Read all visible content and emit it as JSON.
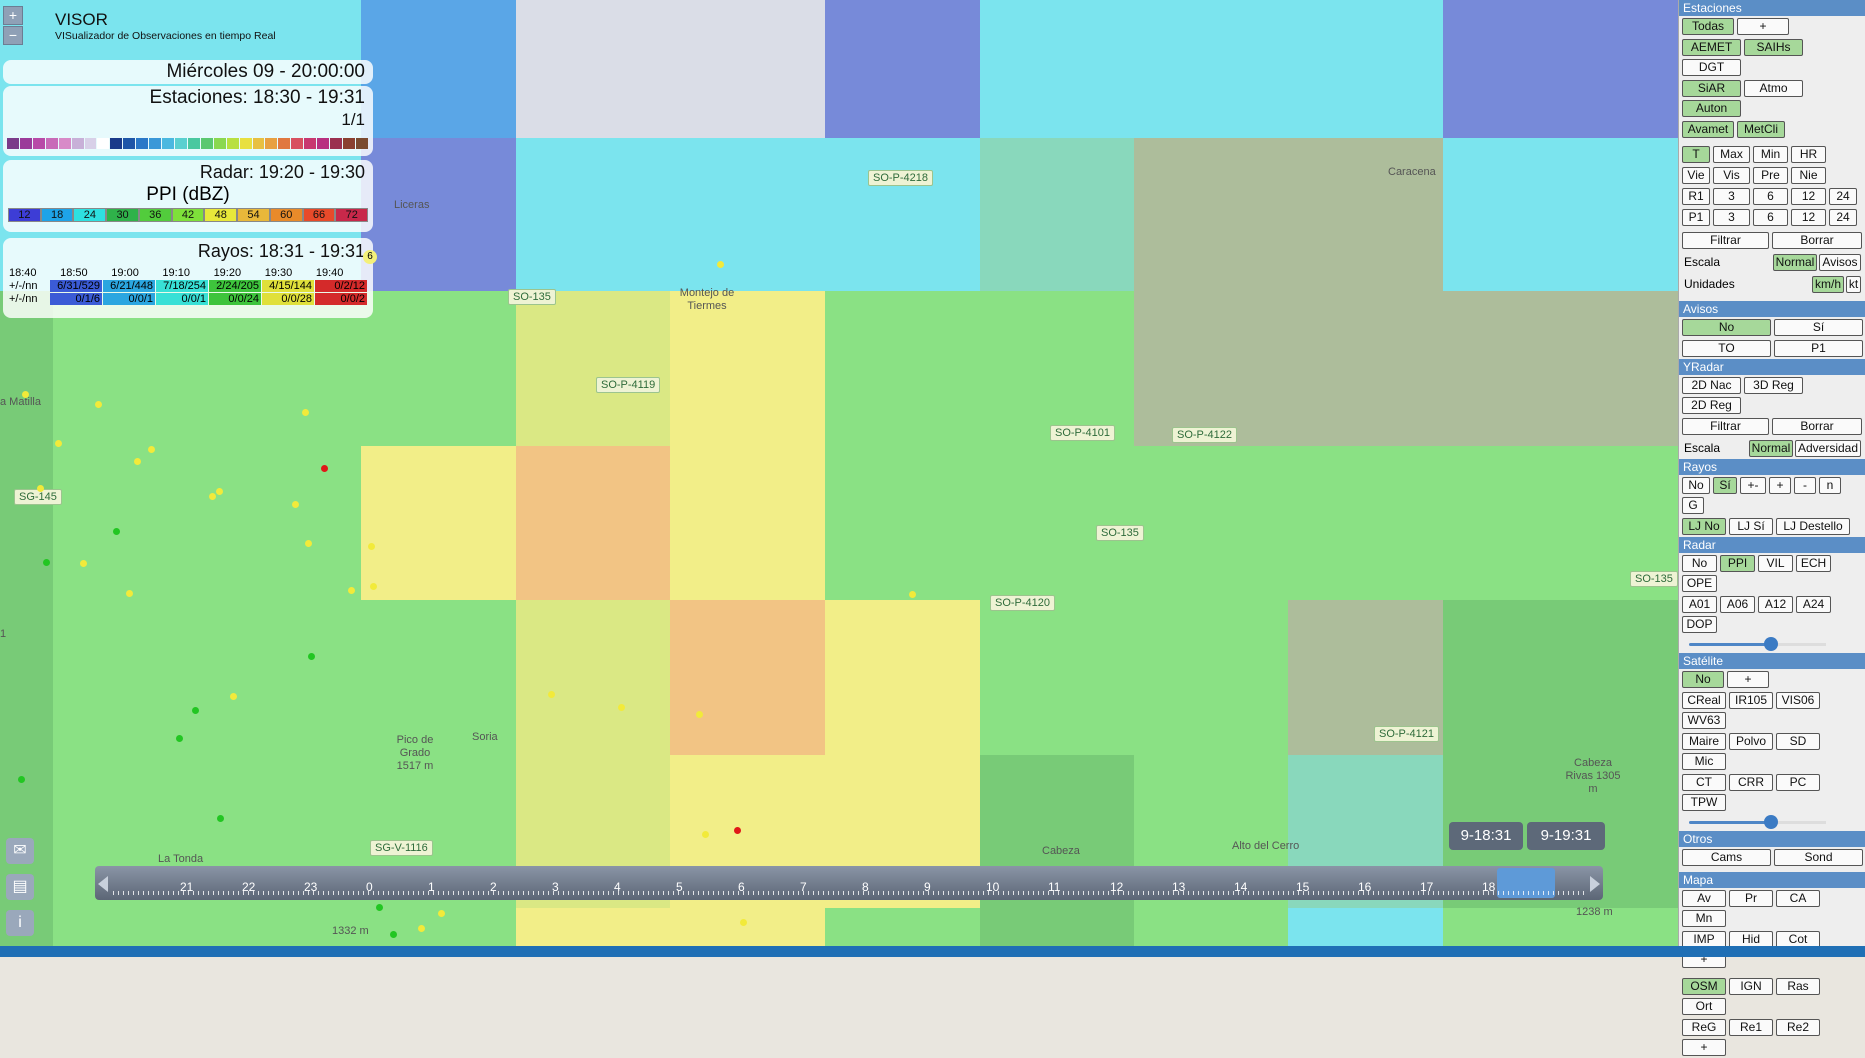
{
  "app": {
    "title": "VISOR",
    "subtitle": "VISualizador de Observaciones en tiempo Real"
  },
  "zoom": {
    "plus": "+",
    "minus": "−"
  },
  "info": {
    "datetime": "Miércoles 09 - 20:00:00",
    "stations": "Estaciones: 18:30 - 19:31",
    "page": "1/1",
    "radar": "Radar: 19:20 - 19:30",
    "radar_product": "PPI (dBZ)",
    "radar_legend": [
      "12",
      "18",
      "24",
      "30",
      "36",
      "42",
      "48",
      "54",
      "60",
      "66",
      "72"
    ],
    "radar_colors": [
      "#3d3dd6",
      "#1ea3e8",
      "#2ee0e0",
      "#2fb24a",
      "#52cc3c",
      "#7ee03a",
      "#e8e83a",
      "#e8b83a",
      "#e88a2a",
      "#e84a2a",
      "#c8284a"
    ],
    "rays": "Rayos: 18:31 - 19:31",
    "rays_badge": "6",
    "ray_times": [
      "18:40",
      "18:50",
      "19:00",
      "19:10",
      "19:20",
      "19:30",
      "19:40"
    ],
    "ray_row1_label": "+/-/nn",
    "ray_row1": [
      "6/31/529",
      "6/21/448",
      "7/18/254",
      "2/24/205",
      "4/15/144",
      "0/2/12"
    ],
    "ray_row2_label": "+/-/nn",
    "ray_row2": [
      "0/1/6",
      "0/0/1",
      "0/0/1",
      "0/0/24",
      "0/0/28",
      "0/0/2"
    ],
    "ray_colors": [
      "#3b5bd6",
      "#2ba6e0",
      "#38e0d6",
      "#3ec43c",
      "#e0e03a",
      "#d42a2a"
    ],
    "station_legend": [
      "#7b3b8a",
      "#9b3b9a",
      "#b84aa8",
      "#c86ab8",
      "#d88ac8",
      "#c8b0d8",
      "#d8d0e8",
      "#ffffff",
      "#1a3a8a",
      "#1e56a8",
      "#2a78c8",
      "#3a98d8",
      "#4ab8e0",
      "#5ad0d0",
      "#4ac8a0",
      "#5ac870",
      "#8ad850",
      "#b8e040",
      "#e8e040",
      "#e8c040",
      "#e8a040",
      "#e07840",
      "#d85060",
      "#c83870",
      "#b83080",
      "#9b3050",
      "#8a4030",
      "#7a4a30"
    ]
  },
  "map": {
    "roads": [
      "SO-P-4218",
      "SO-135",
      "SO-P-4119",
      "SO-P-4101",
      "SO-P-4122",
      "SG-145",
      "SO-135",
      "SO-P-4120",
      "SO-135",
      "SO-P-4121",
      "SG-V-1116"
    ],
    "places": [
      "Caracena",
      "Liceras",
      "Montejo de Tiermes",
      "a Matilla",
      "Pico de Grado 1517 m",
      "Cabeza Rivas 1305 m",
      "Alto del Cerro",
      "Cabeza",
      "La Tonda",
      "1332 m",
      "1238 m",
      "Soria",
      "1"
    ]
  },
  "timeline": {
    "ticks": [
      "21",
      "22",
      "23",
      "0",
      "1",
      "2",
      "3",
      "4",
      "5",
      "6",
      "7",
      "8",
      "9",
      "10",
      "11",
      "12",
      "13",
      "14",
      "15",
      "16",
      "17",
      "18"
    ],
    "tooltip_start": "9-18:31",
    "tooltip_end": "9-19:31"
  },
  "panel": {
    "estaciones": {
      "header": "Estaciones",
      "row1": [
        "Todas",
        "+"
      ],
      "row2": [
        "AEMET",
        "SAIHs",
        "DGT"
      ],
      "row3": [
        "SiAR",
        "Atmo",
        "Auton"
      ],
      "row4": [
        "Avamet",
        "MetCli"
      ]
    },
    "vars": {
      "row1": [
        "T",
        "Max",
        "Min",
        "HR"
      ],
      "row2": [
        "Vie",
        "Vis",
        "Pre",
        "Nie"
      ],
      "row3": [
        "R1",
        "3",
        "6",
        "12",
        "24"
      ],
      "row4": [
        "P1",
        "3",
        "6",
        "12",
        "24"
      ],
      "filter": "Filtrar",
      "clear": "Borrar",
      "scale_label": "Escala",
      "scale": [
        "Normal",
        "Avisos"
      ],
      "units_label": "Unidades",
      "units": [
        "km/h",
        "kt"
      ]
    },
    "avisos": {
      "header": "Avisos",
      "row1": [
        "No",
        "Sí"
      ],
      "row2": [
        "TO",
        "P1"
      ]
    },
    "yradar": {
      "header": "YRadar",
      "row1": [
        "2D Nac",
        "3D Reg",
        "2D Reg"
      ],
      "filter": "Filtrar",
      "clear": "Borrar",
      "scale_label": "Escala",
      "scale": [
        "Normal",
        "Adversidad"
      ]
    },
    "rayos": {
      "header": "Rayos",
      "row1": [
        "No",
        "Sí",
        "+-",
        "+",
        "-",
        "n",
        "G"
      ],
      "row2": [
        "LJ No",
        "LJ Sí",
        "LJ Destello"
      ]
    },
    "radar": {
      "header": "Radar",
      "row1": [
        "No",
        "PPI",
        "VIL",
        "ECH",
        "OPE"
      ],
      "row2": [
        "A01",
        "A06",
        "A12",
        "A24",
        "DOP"
      ],
      "opacity": 0.6
    },
    "satelite": {
      "header": "Satélite",
      "row1": [
        "No",
        "+"
      ],
      "row2": [
        "CReal",
        "IR105",
        "VIS06",
        "WV63"
      ],
      "row3": [
        "Maire",
        "Polvo",
        "SD",
        "Mic"
      ],
      "row4": [
        "CT",
        "CRR",
        "PC",
        "TPW"
      ],
      "opacity": 0.6
    },
    "otros": {
      "header": "Otros",
      "row1": [
        "Cams",
        "Sond"
      ]
    },
    "mapa": {
      "header": "Mapa",
      "row1": [
        "Av",
        "Pr",
        "CA",
        "Mn"
      ],
      "row2": [
        "IMP",
        "Hid",
        "Cot",
        "+"
      ],
      "row3": [
        "OSM",
        "IGN",
        "Ras",
        "Ort"
      ],
      "row4": [
        "ReG",
        "Re1",
        "Re2",
        "+"
      ]
    }
  }
}
